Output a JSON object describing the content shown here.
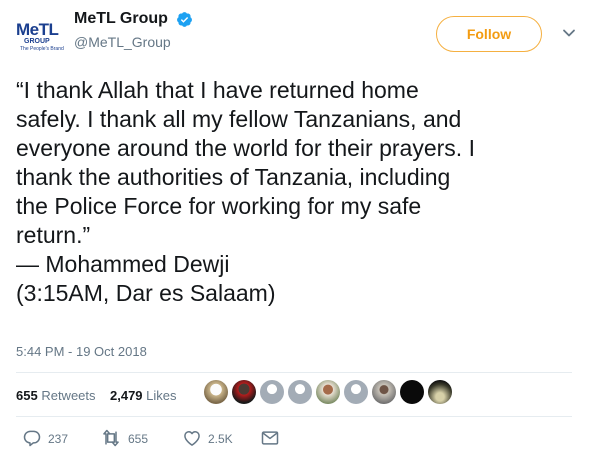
{
  "header": {
    "logo_text_me": "Me",
    "logo_text_tl": "TL",
    "logo_sub": "GROUP",
    "logo_tag": "The People's Brand",
    "display_name": "MeTL Group",
    "handle": "@MeTL_Group",
    "follow_label": "Follow"
  },
  "tweet": {
    "lines": [
      "“I thank Allah that I have returned home",
      "safely. I thank all my fellow Tanzanians, and",
      "everyone around the world for their prayers. I",
      "thank the authorities of Tanzania, including",
      "the Police Force for working for my safe",
      "return.”",
      "— Mohammed Dewji",
      "(3:15AM, Dar es Salaam)"
    ],
    "timestamp": "5:44 PM - 19 Oct 2018"
  },
  "stats": {
    "retweets_count": "655",
    "retweets_label": "Retweets",
    "likes_count": "2,479",
    "likes_label": "Likes"
  },
  "actions": {
    "replies": "237",
    "retweets": "655",
    "likes": "2.5K"
  },
  "colors": {
    "accent": "#f39c12",
    "verified": "#1da1f2",
    "muted": "#657786"
  }
}
